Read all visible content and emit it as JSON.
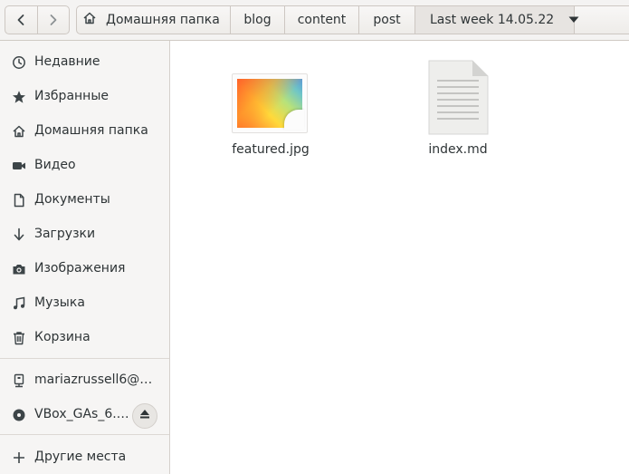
{
  "header": {
    "nav": {
      "back_icon": "go-previous-icon",
      "forward_icon": "go-next-icon"
    },
    "breadcrumbs": [
      {
        "label": "Домашняя папка",
        "icon": "home-icon"
      },
      {
        "label": "blog"
      },
      {
        "label": "content"
      },
      {
        "label": "post"
      },
      {
        "label": "Last week 14.05.22",
        "current": true,
        "icon": "chevron-down-icon"
      }
    ]
  },
  "sidebar": {
    "items": [
      {
        "label": "Недавние",
        "icon": "clock-icon"
      },
      {
        "label": "Избранные",
        "icon": "star-icon"
      },
      {
        "label": "Домашняя папка",
        "icon": "home-icon"
      },
      {
        "label": "Видео",
        "icon": "video-camera-icon"
      },
      {
        "label": "Документы",
        "icon": "document-icon"
      },
      {
        "label": "Загрузки",
        "icon": "download-arrow-icon"
      },
      {
        "label": "Изображения",
        "icon": "camera-icon"
      },
      {
        "label": "Музыка",
        "icon": "music-note-icon"
      },
      {
        "label": "Корзина",
        "icon": "trash-icon"
      }
    ],
    "devices": [
      {
        "label": "mariazrussell6@…",
        "icon": "network-drive-icon"
      },
      {
        "label": "VBox_GAs_6.…",
        "icon": "optical-disc-icon",
        "action_icon": "eject-icon"
      }
    ],
    "other": {
      "label": "Другие места",
      "icon": "plus-icon"
    }
  },
  "files": [
    {
      "name": "featured.jpg",
      "icon": "image-thumbnail-icon"
    },
    {
      "name": "index.md",
      "icon": "text-document-icon"
    }
  ],
  "colors": {
    "headerbar_bg": "#f4f3f2",
    "sidebar_bg": "#f6f5f4",
    "text": "#2e3436",
    "icon": "#3d4548"
  }
}
